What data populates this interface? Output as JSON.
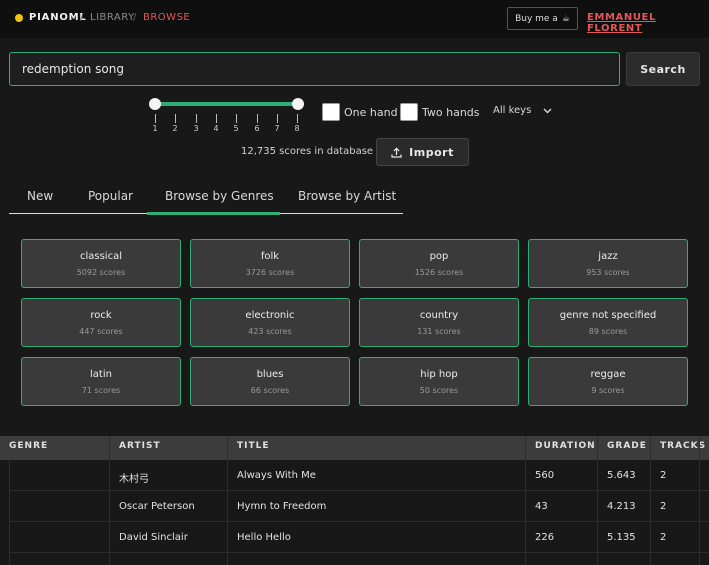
{
  "header": {
    "brand": "PIANOML",
    "breadcrumb": [
      "LIBRARY",
      "BROWSE"
    ],
    "separator": "/",
    "buy_label": "Buy me a",
    "buy_icon": "☕",
    "user_name": "EMMANUEL FLORENT",
    "brand_dot_color": "#f1c40f",
    "accent": "#e0585a"
  },
  "search": {
    "value": "redemption song",
    "button_label": "Search"
  },
  "filters": {
    "slider_ticks": [
      "1",
      "2",
      "3",
      "4",
      "5",
      "6",
      "7",
      "8"
    ],
    "slider_range": [
      1,
      8
    ],
    "one_hand_label": "One hand",
    "two_hands_label": "Two hands",
    "keys_value": "All keys",
    "keys_chevron": "⌄"
  },
  "database": {
    "count_text": "12,735 scores in database",
    "import_label": "Import",
    "import_icon": "upload-icon"
  },
  "tabs": [
    {
      "label": "New"
    },
    {
      "label": "Popular"
    },
    {
      "label": "Browse by Genres",
      "active": true
    },
    {
      "label": "Browse by Artist"
    }
  ],
  "genres": [
    {
      "name": "classical",
      "count": "5092 scores"
    },
    {
      "name": "folk",
      "count": "3726 scores"
    },
    {
      "name": "pop",
      "count": "1526 scores"
    },
    {
      "name": "jazz",
      "count": "953 scores"
    },
    {
      "name": "rock",
      "count": "447 scores"
    },
    {
      "name": "electronic",
      "count": "423 scores"
    },
    {
      "name": "country",
      "count": "131 scores"
    },
    {
      "name": "genre not specified",
      "count": "89 scores"
    },
    {
      "name": "latin",
      "count": "71 scores"
    },
    {
      "name": "blues",
      "count": "66 scores"
    },
    {
      "name": "hip hop",
      "count": "50 scores"
    },
    {
      "name": "reggae",
      "count": "9 scores"
    }
  ],
  "table": {
    "headers": [
      "GENRE",
      "ARTIST",
      "TITLE",
      "DURATION",
      "GRADE",
      "TRACKS"
    ],
    "rows": [
      {
        "genre": "",
        "artist": "木村弓",
        "title": "Always With Me",
        "duration": "560",
        "grade": "5.643",
        "tracks": "2"
      },
      {
        "genre": "",
        "artist": "Oscar Peterson",
        "title": "Hymn to Freedom",
        "duration": "43",
        "grade": "4.213",
        "tracks": "2"
      },
      {
        "genre": "",
        "artist": "David Sinclair",
        "title": "Hello Hello",
        "duration": "226",
        "grade": "5.135",
        "tracks": "2"
      }
    ]
  },
  "colors": {
    "green": "#2fae76",
    "background": "#181818"
  }
}
